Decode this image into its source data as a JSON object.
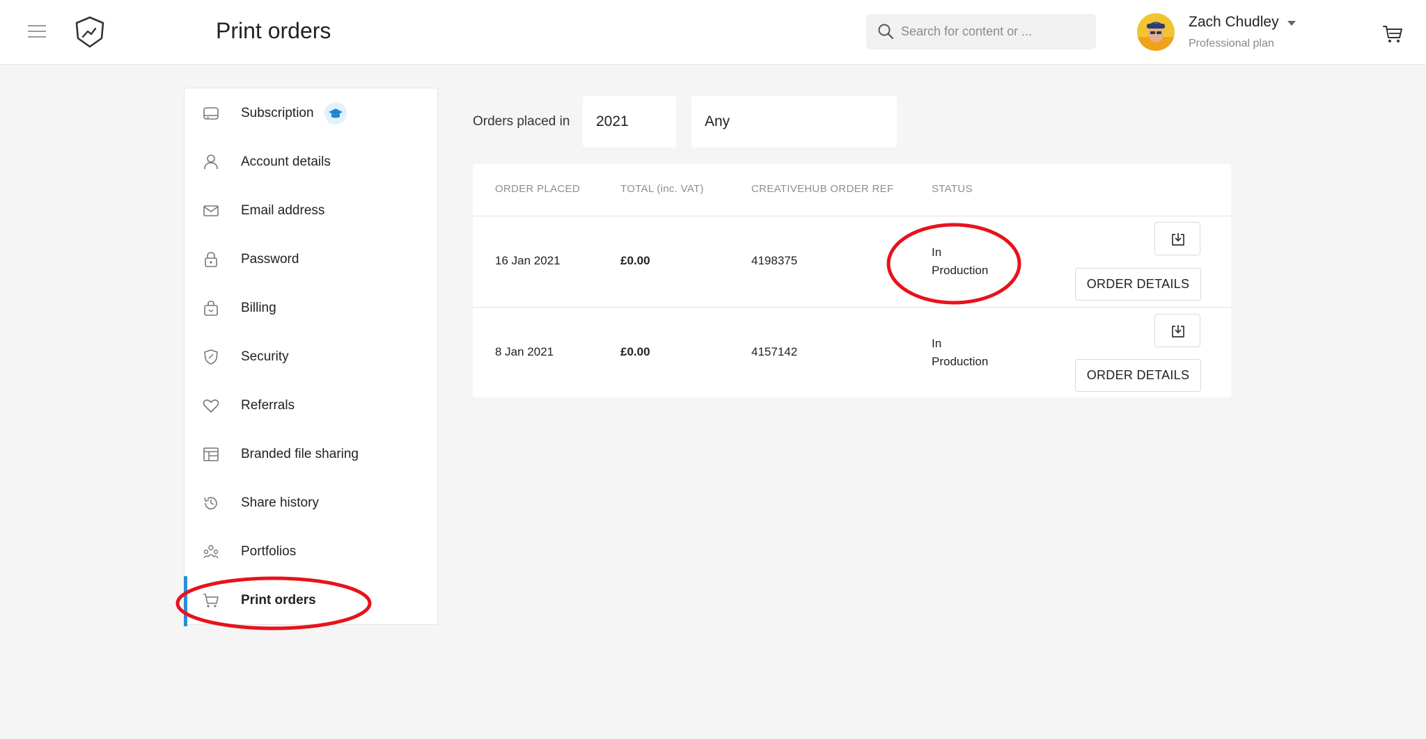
{
  "header": {
    "title": "Print orders",
    "search_placeholder": "Search for content or ...",
    "user_name": "Zach Chudley",
    "user_plan": "Professional plan"
  },
  "sidebar": {
    "items": [
      {
        "label": "Subscription",
        "icon": "subscription-icon"
      },
      {
        "label": "Account details",
        "icon": "user-icon"
      },
      {
        "label": "Email address",
        "icon": "envelope-icon"
      },
      {
        "label": "Password",
        "icon": "lock-icon"
      },
      {
        "label": "Billing",
        "icon": "billing-bag-icon"
      },
      {
        "label": "Security",
        "icon": "shield-icon"
      },
      {
        "label": "Referrals",
        "icon": "heart-icon"
      },
      {
        "label": "Branded file sharing",
        "icon": "layout-icon"
      },
      {
        "label": "Share history",
        "icon": "history-icon"
      },
      {
        "label": "Portfolios",
        "icon": "portfolio-icon"
      },
      {
        "label": "Print orders",
        "icon": "cart-icon",
        "active": true
      }
    ]
  },
  "filter": {
    "label": "Orders placed in",
    "year": "2021",
    "status": "Any"
  },
  "table": {
    "columns": [
      "ORDER PLACED",
      "TOTAL (inc. VAT)",
      "CREATIVEHUB ORDER REF",
      "STATUS"
    ],
    "rows": [
      {
        "date": "16 Jan 2021",
        "total": "£0.00",
        "ref": "4198375",
        "status_line1": "In",
        "status_line2": "Production",
        "action": "ORDER DETAILS"
      },
      {
        "date": "8 Jan 2021",
        "total": "£0.00",
        "ref": "4157142",
        "status_line1": "In",
        "status_line2": "Production",
        "action": "ORDER DETAILS"
      }
    ]
  },
  "colors": {
    "accent": "#2a8fd6",
    "annotation": "#e8121c"
  }
}
